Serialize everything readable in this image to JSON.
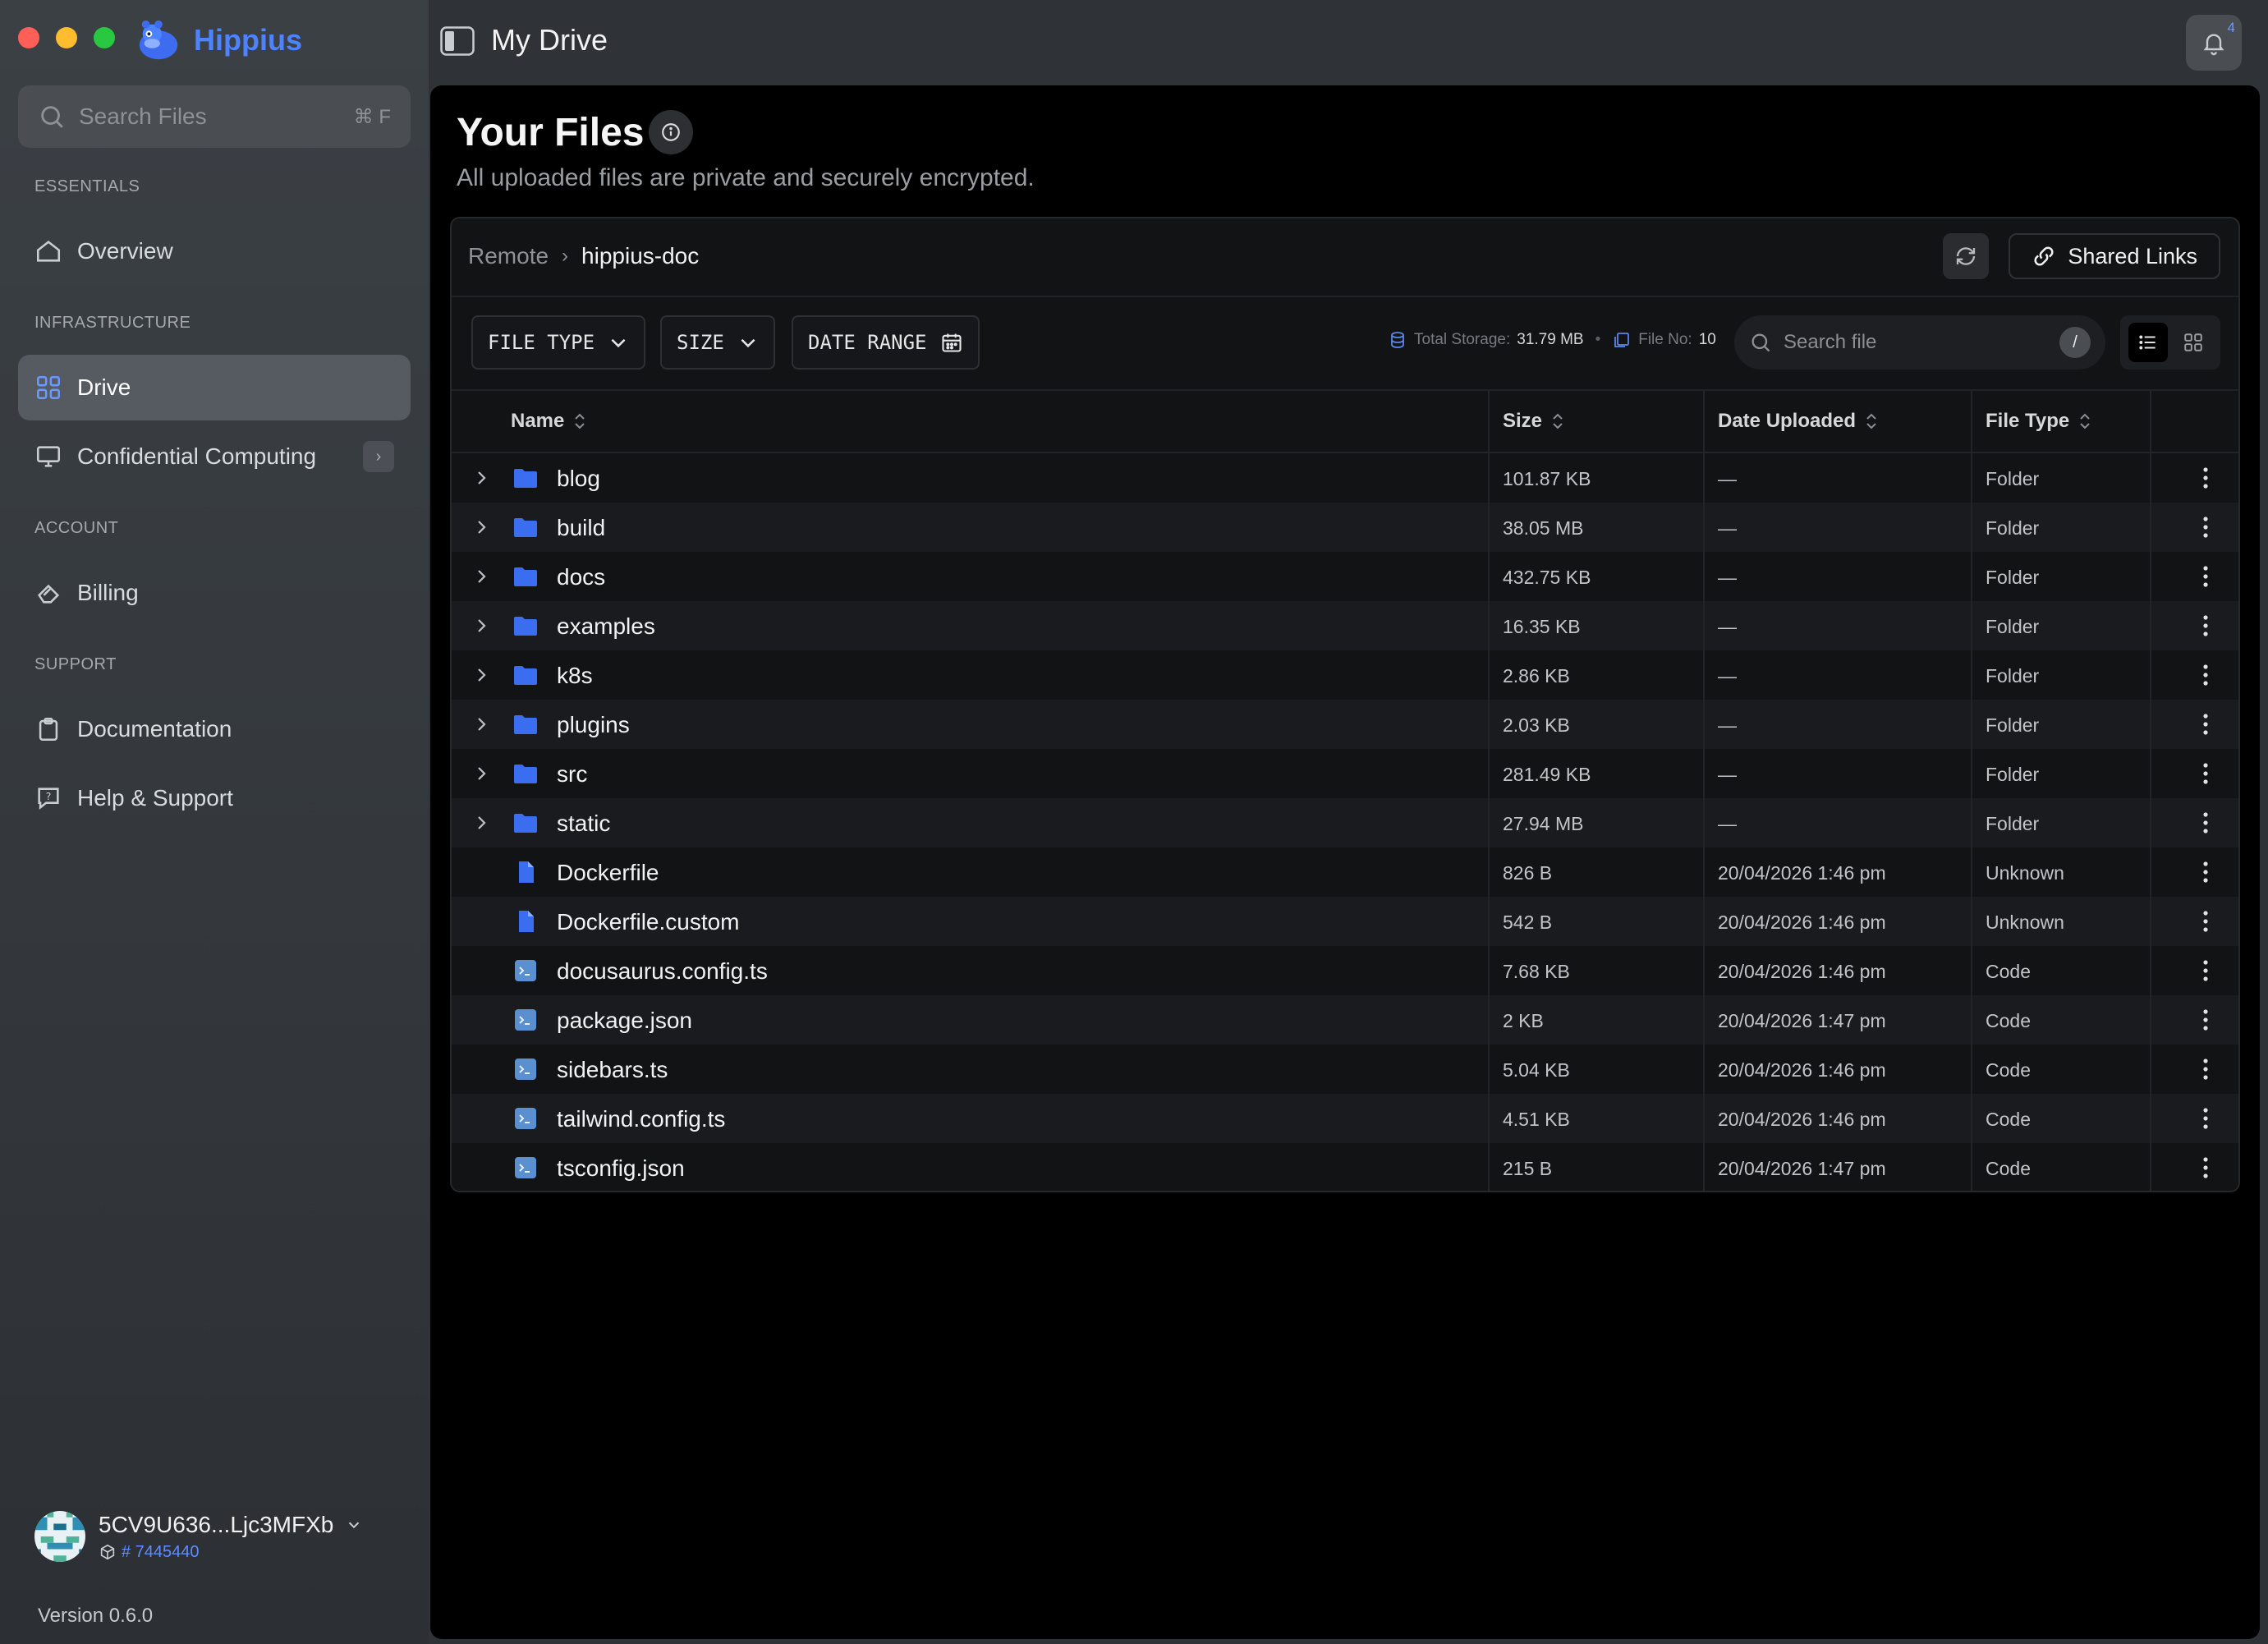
{
  "app": {
    "brand": "Hippius",
    "window_title": "My Drive",
    "notification_count": "4",
    "version": "Version 0.6.0"
  },
  "sidebar": {
    "search_placeholder": "Search Files",
    "search_shortcut": "⌘ F",
    "sections": {
      "essentials": "ESSENTIALS",
      "infrastructure": "INFRASTRUCTURE",
      "account": "ACCOUNT",
      "support": "SUPPORT"
    },
    "items": {
      "overview": "Overview",
      "drive": "Drive",
      "confidential": "Confidential Computing",
      "billing": "Billing",
      "documentation": "Documentation",
      "help": "Help & Support"
    },
    "active_item": "Drive",
    "account": {
      "name": "5CV9U636...Ljc3MFXb",
      "id": "# 7445440"
    }
  },
  "main": {
    "title": "Your Files",
    "subtitle": "All uploaded files are private and securely encrypted.",
    "breadcrumb": [
      "Remote",
      "hippius-doc"
    ],
    "shared_links": "Shared Links",
    "filters": {
      "file_type": "FILE TYPE",
      "size": "SIZE",
      "date_range": "DATE RANGE"
    },
    "stats": {
      "storage_label": "Total Storage:",
      "storage_value": "31.79 MB",
      "count_label": "File No:",
      "count_value": "10"
    },
    "search_placeholder": "Search file",
    "search_shortcut": "/",
    "view_mode": "list",
    "columns": {
      "name": "Name",
      "size": "Size",
      "date": "Date Uploaded",
      "type": "File Type"
    },
    "rows": [
      {
        "kind": "folder",
        "name": "blog",
        "size": "101.87 KB",
        "date": "—",
        "type": "Folder"
      },
      {
        "kind": "folder",
        "name": "build",
        "size": "38.05 MB",
        "date": "—",
        "type": "Folder"
      },
      {
        "kind": "folder",
        "name": "docs",
        "size": "432.75 KB",
        "date": "—",
        "type": "Folder"
      },
      {
        "kind": "folder",
        "name": "examples",
        "size": "16.35 KB",
        "date": "—",
        "type": "Folder"
      },
      {
        "kind": "folder",
        "name": "k8s",
        "size": "2.86 KB",
        "date": "—",
        "type": "Folder"
      },
      {
        "kind": "folder",
        "name": "plugins",
        "size": "2.03 KB",
        "date": "—",
        "type": "Folder"
      },
      {
        "kind": "folder",
        "name": "src",
        "size": "281.49 KB",
        "date": "—",
        "type": "Folder"
      },
      {
        "kind": "folder",
        "name": "static",
        "size": "27.94 MB",
        "date": "—",
        "type": "Folder"
      },
      {
        "kind": "file",
        "name": "Dockerfile",
        "size": "826 B",
        "date": "20/04/2026 1:46 pm",
        "type": "Unknown"
      },
      {
        "kind": "file",
        "name": "Dockerfile.custom",
        "size": "542 B",
        "date": "20/04/2026 1:46 pm",
        "type": "Unknown"
      },
      {
        "kind": "code",
        "name": "docusaurus.config.ts",
        "size": "7.68 KB",
        "date": "20/04/2026 1:46 pm",
        "type": "Code"
      },
      {
        "kind": "code",
        "name": "package.json",
        "size": "2 KB",
        "date": "20/04/2026 1:47 pm",
        "type": "Code"
      },
      {
        "kind": "code",
        "name": "sidebars.ts",
        "size": "5.04 KB",
        "date": "20/04/2026 1:46 pm",
        "type": "Code"
      },
      {
        "kind": "code",
        "name": "tailwind.config.ts",
        "size": "4.51 KB",
        "date": "20/04/2026 1:46 pm",
        "type": "Code"
      },
      {
        "kind": "code",
        "name": "tsconfig.json",
        "size": "215 B",
        "date": "20/04/2026 1:47 pm",
        "type": "Code"
      }
    ]
  },
  "colors": {
    "accent": "#4d83ff",
    "folder": "#3a6df0",
    "code": "#5a8fd0"
  }
}
